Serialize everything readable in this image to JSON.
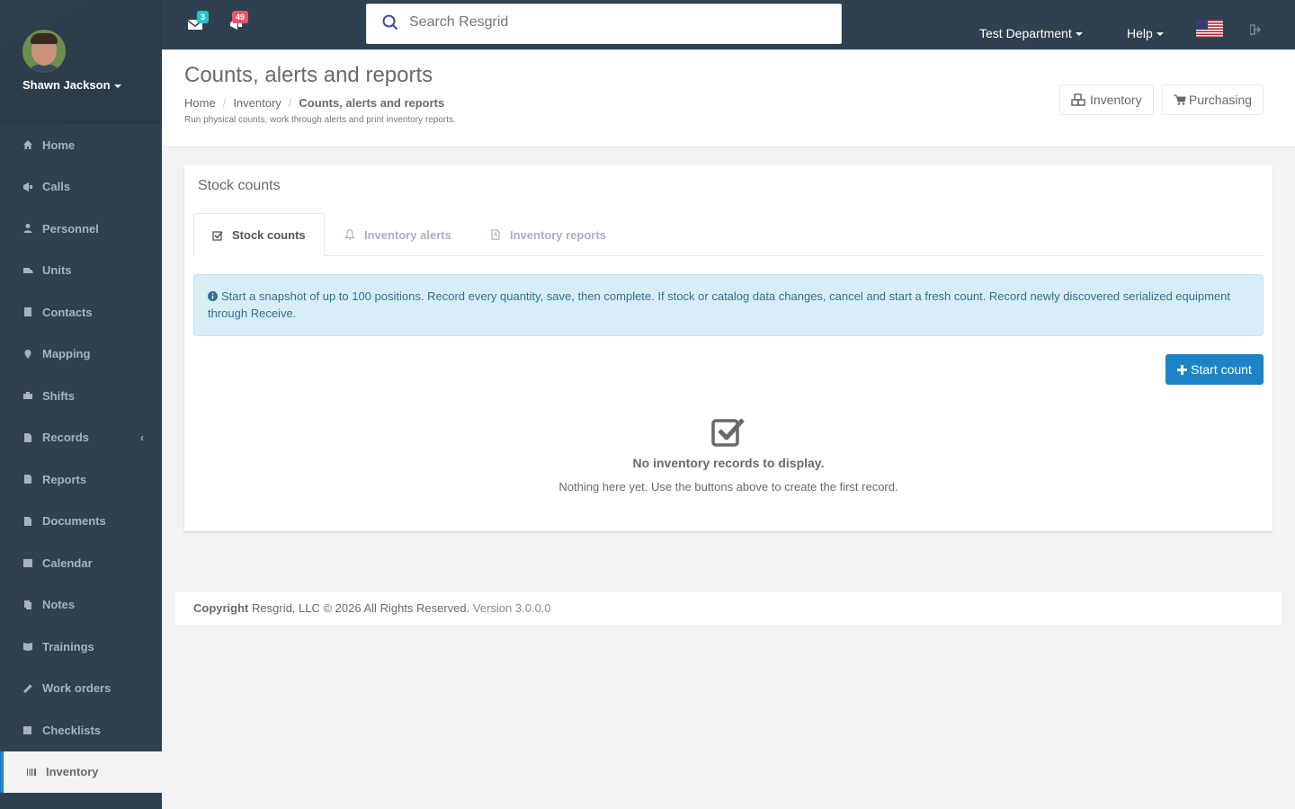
{
  "profile": {
    "name": "Shawn Jackson"
  },
  "sidebar": {
    "items": [
      {
        "label": "Home",
        "icon": "home-icon"
      },
      {
        "label": "Calls",
        "icon": "bullhorn-icon"
      },
      {
        "label": "Personnel",
        "icon": "user-icon"
      },
      {
        "label": "Units",
        "icon": "truck-icon"
      },
      {
        "label": "Contacts",
        "icon": "address-book-icon"
      },
      {
        "label": "Mapping",
        "icon": "map-marker-icon"
      },
      {
        "label": "Shifts",
        "icon": "briefcase-icon"
      },
      {
        "label": "Records",
        "icon": "file-icon",
        "arrow": "‹"
      },
      {
        "label": "Reports",
        "icon": "reports-icon"
      },
      {
        "label": "Documents",
        "icon": "document-icon"
      },
      {
        "label": "Calendar",
        "icon": "calendar-icon"
      },
      {
        "label": "Notes",
        "icon": "notes-icon"
      },
      {
        "label": "Trainings",
        "icon": "book-icon"
      },
      {
        "label": "Work orders",
        "icon": "wrench-icon"
      },
      {
        "label": "Checklists",
        "icon": "checklist-icon"
      },
      {
        "label": "Inventory",
        "icon": "barcode-icon",
        "active": true
      }
    ]
  },
  "topbar": {
    "messages_count": "3",
    "calls_count": "49",
    "search_placeholder": "Search Resgrid",
    "department": "Test Department",
    "help": "Help"
  },
  "heading": {
    "title": "Counts, alerts and reports",
    "breadcrumb": [
      "Home",
      "Inventory",
      "Counts, alerts and reports"
    ],
    "subtitle": "Run physical counts, work through alerts and print inventory reports.",
    "buttons": [
      "Inventory",
      "Purchasing"
    ]
  },
  "panel": {
    "title": "Stock counts",
    "tabs": [
      "Stock counts",
      "Inventory alerts",
      "Inventory reports"
    ],
    "alert": "Start a snapshot of up to 100 positions. Record every quantity, save, then complete. If stock or catalog data changes, cancel and start a fresh count. Record newly discovered serialized equipment through Receive.",
    "start_button": "Start count",
    "empty_title": "No inventory records to display.",
    "empty_text": "Nothing here yet. Use the buttons above to create the first record."
  },
  "footer": {
    "copyright_label": "Copyright",
    "copyright_text": "Resgrid, LLC © 2026 All Rights Reserved.",
    "version": "Version 3.0.0.0"
  },
  "colors": {
    "sidebar_bg": "#2f4050",
    "accent": "#1c84c6",
    "badge_teal": "#23c6c8",
    "badge_red": "#ed5565",
    "alert_bg": "#d9edf7"
  }
}
